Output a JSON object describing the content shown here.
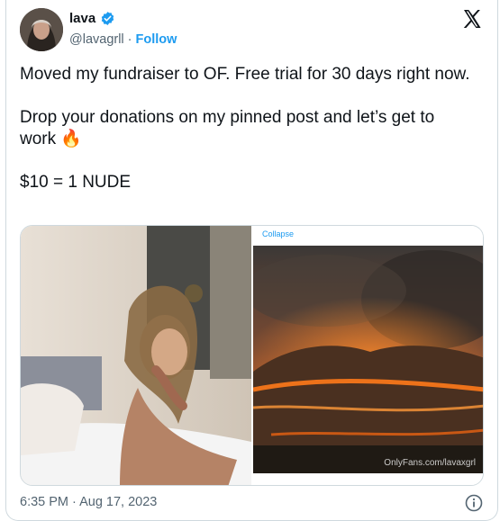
{
  "user": {
    "display_name": "lava",
    "handle": "@lavagrll",
    "separator": "·",
    "follow_label": "Follow"
  },
  "tweet": {
    "line1": "Moved my fundraiser to OF. Free trial for 30 days right now.",
    "line2": "Drop your donations on my pinned post and let’s get to work 🔥",
    "line3": "$10 = 1 NUDE"
  },
  "media": {
    "collapse_label": "Collapse",
    "watermark": "OnlyFans.com/lavaxgrl"
  },
  "footer": {
    "timestamp": "6:35 PM · Aug 17, 2023"
  },
  "colors": {
    "accent": "#1d9bf0",
    "verified": "#1d9bf0",
    "muted": "#536471"
  },
  "icons": {
    "verified": "verified-badge-icon",
    "x_logo": "x-logo-icon",
    "info": "info-icon"
  }
}
